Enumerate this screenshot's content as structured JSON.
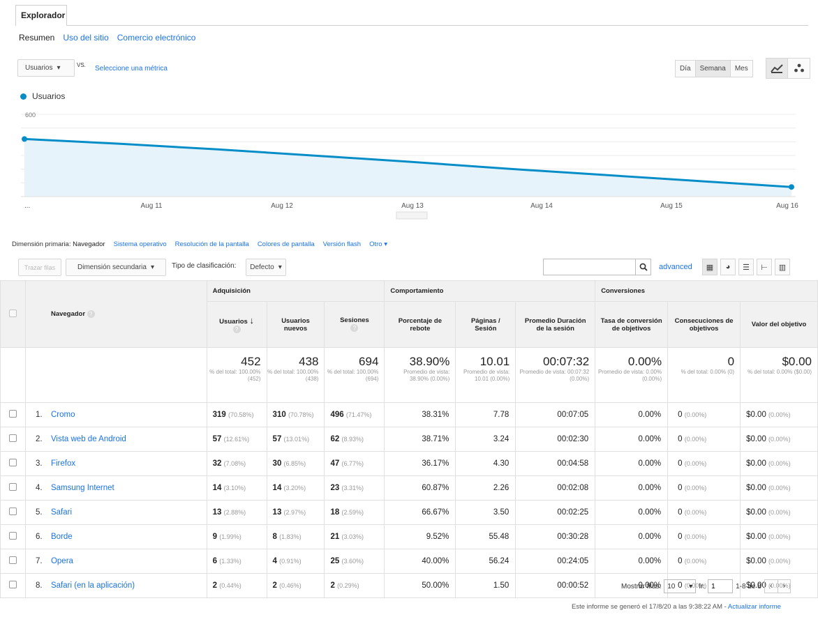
{
  "explorer_tab": "Explorador",
  "subtabs": [
    "Resumen",
    "Uso del sitio",
    "Comercio electrónico"
  ],
  "metric_selector": {
    "value": "Usuarios",
    "vs": "VS.",
    "compare_link": "Seleccione una métrica"
  },
  "period_buttons": [
    "Día",
    "Semana",
    "Mes"
  ],
  "period_active": "Semana",
  "legend_label": "Usuarios",
  "colors": {
    "series": "#058dc7",
    "fill": "#e6f3fa",
    "link": "#1a73e8"
  },
  "chart_data": {
    "type": "area",
    "series": [
      {
        "name": "Usuarios",
        "values": [
          420,
          385,
          345,
          300,
          255,
          205,
          160,
          115,
          70
        ]
      }
    ],
    "x_ticks": [
      "...",
      "Aug 11",
      "Aug 12",
      "Aug 13",
      "Aug 14",
      "Aug 15",
      "Aug 16"
    ],
    "y_ticks": [
      "600",
      "400",
      "200"
    ],
    "ylim": [
      0,
      600
    ],
    "grid": true
  },
  "dimension": {
    "label": "Dimensión primaria:",
    "active": "Navegador",
    "links": [
      "Sistema operativo",
      "Resolución de la pantalla",
      "Colores de pantalla",
      "Versión flash"
    ],
    "other": "Otro"
  },
  "toolbar": {
    "plot_rows": "Trazar filas",
    "secondary_dimension": "Dimensión secundaria",
    "sort_label": "Tipo de clasificación:",
    "sort_value": "Defecto",
    "search_placeholder": "",
    "advanced": "advanced"
  },
  "table": {
    "groups": [
      "Adquisición",
      "Comportamiento",
      "Conversiones"
    ],
    "headers": {
      "browser": "Navegador",
      "users": "Usuarios",
      "new_users": "Usuarios nuevos",
      "sessions": "Sesiones",
      "bounce": "Porcentaje de rebote",
      "pages": "Páginas / Sesión",
      "duration": "Promedio Duración de la sesión",
      "conv_rate": "Tasa de conversión de objetivos",
      "goal_completions": "Consecuciones de objetivos",
      "goal_value": "Valor del objetivo"
    },
    "summary": {
      "users": {
        "value": "452",
        "sub": "% del total: 100.00% (452)"
      },
      "new_users": {
        "value": "438",
        "sub": "% del total: 100.00% (438)"
      },
      "sessions": {
        "value": "694",
        "sub": "% del total: 100.00% (694)"
      },
      "bounce": {
        "value": "38.90%",
        "sub": "Promedio de vista: 38.90% (0.00%)"
      },
      "pages": {
        "value": "10.01",
        "sub": "Promedio de vista: 10.01 (0.00%)"
      },
      "duration": {
        "value": "00:07:32",
        "sub": "Promedio de vista: 00:07:32 (0.00%)"
      },
      "conv_rate": {
        "value": "0.00%",
        "sub": "Promedio de vista: 0.00% (0.00%)"
      },
      "goal_completions": {
        "value": "0",
        "sub": "% del total: 0.00% (0)"
      },
      "goal_value": {
        "value": "$0.00",
        "sub": "% del total: 0.00% ($0.00)"
      }
    },
    "rows": [
      {
        "idx": "1.",
        "name": "Cromo",
        "users": "319",
        "users_pct": "(70.58%)",
        "new_users": "310",
        "new_users_pct": "(70.78%)",
        "sessions": "496",
        "sessions_pct": "(71.47%)",
        "bounce": "38.31%",
        "pages": "7.78",
        "duration": "00:07:05",
        "conv": "0.00%",
        "goals": "0",
        "goals_pct": "(0.00%)",
        "value": "$0.00",
        "value_pct": "(0.00%)"
      },
      {
        "idx": "2.",
        "name": "Vista web de Android",
        "users": "57",
        "users_pct": "(12.61%)",
        "new_users": "57",
        "new_users_pct": "(13.01%)",
        "sessions": "62",
        "sessions_pct": "(8.93%)",
        "bounce": "38.71%",
        "pages": "3.24",
        "duration": "00:02:30",
        "conv": "0.00%",
        "goals": "0",
        "goals_pct": "(0.00%)",
        "value": "$0.00",
        "value_pct": "(0.00%)"
      },
      {
        "idx": "3.",
        "name": "Firefox",
        "users": "32",
        "users_pct": "(7.08%)",
        "new_users": "30",
        "new_users_pct": "(6.85%)",
        "sessions": "47",
        "sessions_pct": "(6.77%)",
        "bounce": "36.17%",
        "pages": "4.30",
        "duration": "00:04:58",
        "conv": "0.00%",
        "goals": "0",
        "goals_pct": "(0.00%)",
        "value": "$0.00",
        "value_pct": "(0.00%)"
      },
      {
        "idx": "4.",
        "name": "Samsung Internet",
        "users": "14",
        "users_pct": "(3.10%)",
        "new_users": "14",
        "new_users_pct": "(3.20%)",
        "sessions": "23",
        "sessions_pct": "(3.31%)",
        "bounce": "60.87%",
        "pages": "2.26",
        "duration": "00:02:08",
        "conv": "0.00%",
        "goals": "0",
        "goals_pct": "(0.00%)",
        "value": "$0.00",
        "value_pct": "(0.00%)"
      },
      {
        "idx": "5.",
        "name": "Safari",
        "users": "13",
        "users_pct": "(2.88%)",
        "new_users": "13",
        "new_users_pct": "(2.97%)",
        "sessions": "18",
        "sessions_pct": "(2.59%)",
        "bounce": "66.67%",
        "pages": "3.50",
        "duration": "00:02:25",
        "conv": "0.00%",
        "goals": "0",
        "goals_pct": "(0.00%)",
        "value": "$0.00",
        "value_pct": "(0.00%)"
      },
      {
        "idx": "6.",
        "name": "Borde",
        "users": "9",
        "users_pct": "(1.99%)",
        "new_users": "8",
        "new_users_pct": "(1.83%)",
        "sessions": "21",
        "sessions_pct": "(3.03%)",
        "bounce": "9.52%",
        "pages": "55.48",
        "duration": "00:30:28",
        "conv": "0.00%",
        "goals": "0",
        "goals_pct": "(0.00%)",
        "value": "$0.00",
        "value_pct": "(0.00%)"
      },
      {
        "idx": "7.",
        "name": "Opera",
        "users": "6",
        "users_pct": "(1.33%)",
        "new_users": "4",
        "new_users_pct": "(0.91%)",
        "sessions": "25",
        "sessions_pct": "(3.60%)",
        "bounce": "40.00%",
        "pages": "56.24",
        "duration": "00:24:05",
        "conv": "0.00%",
        "goals": "0",
        "goals_pct": "(0.00%)",
        "value": "$0.00",
        "value_pct": "(0.00%)"
      },
      {
        "idx": "8.",
        "name": "Safari (en la aplicación)",
        "users": "2",
        "users_pct": "(0.44%)",
        "new_users": "2",
        "new_users_pct": "(0.46%)",
        "sessions": "2",
        "sessions_pct": "(0.29%)",
        "bounce": "50.00%",
        "pages": "1.50",
        "duration": "00:00:52",
        "conv": "0.00%",
        "goals": "0",
        "goals_pct": "(0.00%)",
        "value": "$0.00",
        "value_pct": "(0.00%)"
      }
    ]
  },
  "pagination": {
    "show_rows_label": "Mostrar filas:",
    "rows_value": "10",
    "goto_label": "Ir:",
    "goto_value": "1",
    "range": "1-8 de 8"
  },
  "footer": {
    "generated": "Este informe se generó el 17/8/20 a las 9:38:22 AM - ",
    "refresh": "Actualizar informe"
  }
}
